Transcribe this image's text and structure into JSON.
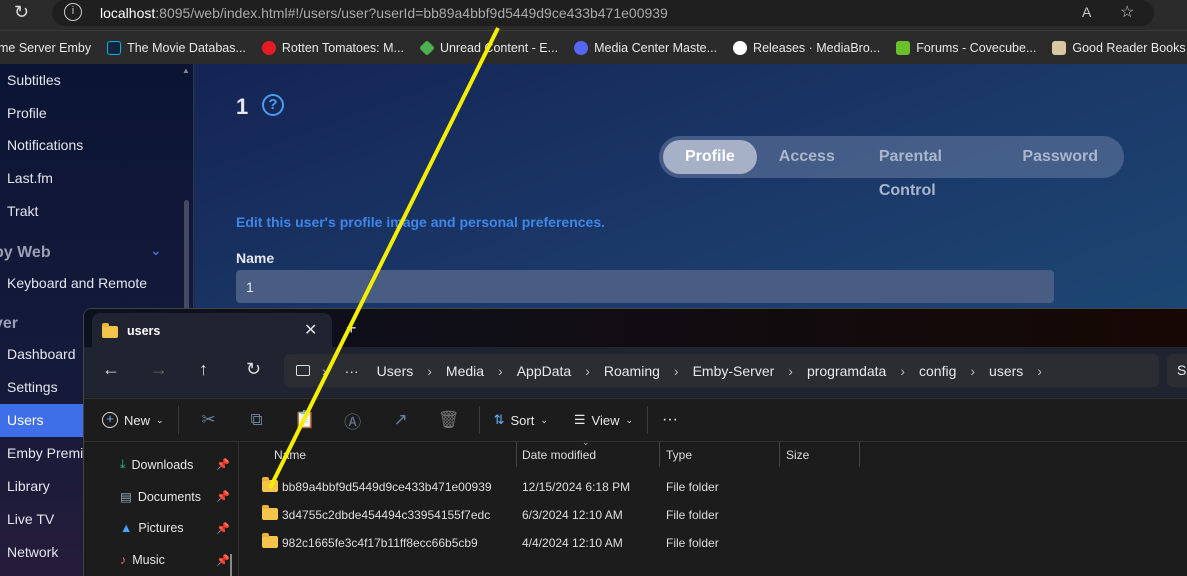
{
  "browser": {
    "url_host": "localhost",
    "url_rest": ":8095/web/index.html#!/users/user?userId=bb89a4bbf9d5449d9ce433b471e00939",
    "bookmarks": [
      {
        "label": "me Server Emby",
        "color": ""
      },
      {
        "label": "The Movie Databas...",
        "color": "#0d253f"
      },
      {
        "label": "Rotten Tomatoes: M...",
        "color": "#e31b23"
      },
      {
        "label": "Unread Content - E...",
        "color": "#4caf50"
      },
      {
        "label": "Media Center Maste...",
        "color": "#5865f2"
      },
      {
        "label": "Releases · MediaBro...",
        "color": "#ffffff"
      },
      {
        "label": "Forums - Covecube...",
        "color": "#6abf2b"
      },
      {
        "label": "Good Reader Books",
        "color": "#d9c9a3"
      }
    ]
  },
  "sidebar": {
    "items": [
      "Subtitles",
      "Profile",
      "Notifications",
      "Last.fm",
      "Trakt"
    ],
    "section1": "by Web",
    "items2": [
      "Keyboard and Remote"
    ],
    "section2": "ver",
    "items3": [
      "Dashboard",
      "Settings",
      "Users",
      "Emby Premi",
      "Library",
      "Live TV",
      "Network"
    ],
    "active": "Users"
  },
  "main": {
    "title": "1",
    "tabs": [
      "Profile",
      "Access",
      "Parental Control",
      "Password"
    ],
    "active_tab": "Profile",
    "description": "Edit this user's profile image and personal preferences.",
    "name_label": "Name",
    "name_value": "1"
  },
  "explorer": {
    "tab_title": "users",
    "breadcrumbs": [
      "Users",
      "Media",
      "AppData",
      "Roaming",
      "Emby-Server",
      "programdata",
      "config",
      "users"
    ],
    "search_partial": "S",
    "commands": {
      "new": "New",
      "sort": "Sort",
      "view": "View"
    },
    "quick_access": [
      "Downloads",
      "Documents",
      "Pictures",
      "Music"
    ],
    "columns": [
      "Name",
      "Date modified",
      "Type",
      "Size"
    ],
    "rows": [
      {
        "name": "bb89a4bbf9d5449d9ce433b471e00939",
        "date": "12/15/2024 6:18 PM",
        "type": "File folder",
        "size": ""
      },
      {
        "name": "3d4755c2dbde454494c33954155f7edc",
        "date": "6/3/2024 12:10 AM",
        "type": "File folder",
        "size": ""
      },
      {
        "name": "982c1665fe3c4f17b11ff8ecc66b5cb9",
        "date": "4/4/2024 12:10 AM",
        "type": "File folder",
        "size": ""
      }
    ]
  },
  "annotation_color": "#f5ee00"
}
